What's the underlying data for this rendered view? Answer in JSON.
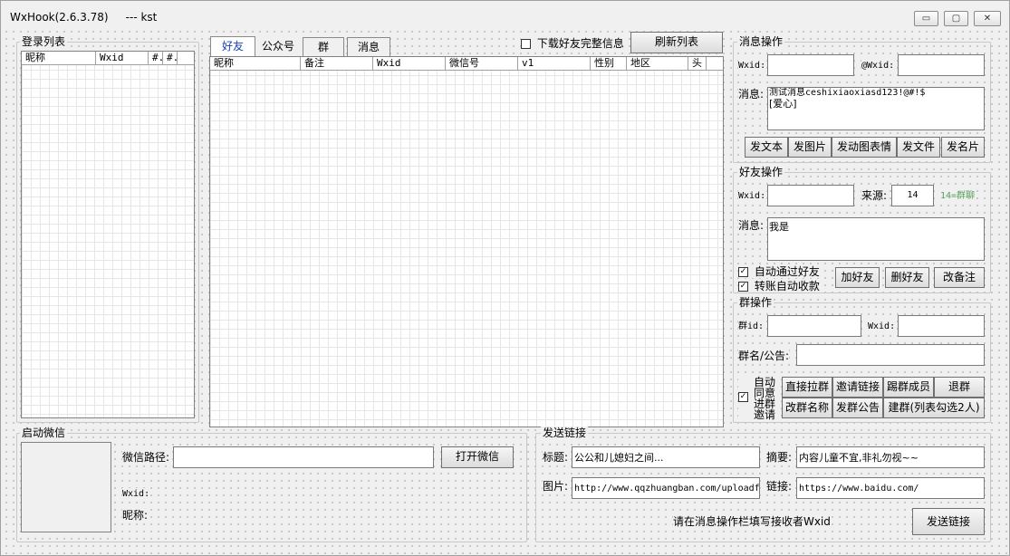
{
  "window": {
    "title": "WxHook(2.6.3.78)     --- kst",
    "minimize_glyph": "▭",
    "maximize_glyph": "▢",
    "close_glyph": "✕"
  },
  "login_list": {
    "title": "登录列表",
    "columns": [
      "昵称",
      "Wxid",
      "#.",
      "#."
    ]
  },
  "tabs": [
    "好友",
    "公众号",
    "群",
    "消息"
  ],
  "download_full_info": {
    "label": "下载好友完整信息",
    "checked": false
  },
  "refresh_button": "刷新列表",
  "friend_table": {
    "columns": [
      "昵称",
      "备注",
      "Wxid",
      "微信号",
      "v1",
      "性别",
      "地区",
      "头"
    ]
  },
  "message_ops": {
    "title": "消息操作",
    "wxid_label": "Wxid:",
    "at_wxid_label": "@Wxid:",
    "message_label": "消息:",
    "message_value_line1": "测试消息ceshixiaoxiasd123!@#!$",
    "message_value_line2": "[爱心]",
    "buttons": [
      "发文本",
      "发图片",
      "发动图表情",
      "发文件",
      "发名片"
    ]
  },
  "friend_ops": {
    "title": "好友操作",
    "wxid_label": "Wxid:",
    "source_label": "来源:",
    "source_value": "14",
    "source_hint": "14=群聊",
    "message_label": "消息:",
    "message_value": "我是",
    "auto_accept": {
      "label": "自动通过好友",
      "checked": true
    },
    "auto_collect": {
      "label": "转账自动收款",
      "checked": true
    },
    "buttons": [
      "加好友",
      "删好友",
      "改备注"
    ]
  },
  "group_ops": {
    "title": "群操作",
    "group_id_label": "群id:",
    "wxid_label": "Wxid:",
    "name_label": "群名/公告:",
    "auto_agree_label": "自动同意进群邀请",
    "auto_agree_lines": [
      "自动",
      "同意",
      "进群",
      "邀请"
    ],
    "auto_agree_checked": true,
    "buttons_row1": [
      "直接拉群",
      "邀请链接",
      "踢群成员",
      "退群"
    ],
    "buttons_row2": [
      "改群名称",
      "发群公告",
      "建群(列表勾选2人)"
    ]
  },
  "start_wechat": {
    "title": "启动微信",
    "path_label": "微信路径:",
    "open_button": "打开微信",
    "wxid_label": "Wxid:",
    "nickname_label": "昵称:"
  },
  "send_link": {
    "title": "发送链接",
    "title_label": "标题:",
    "title_value": "公公和儿媳妇之间...",
    "summary_label": "摘要:",
    "summary_value": "内容儿童不宜,非礼勿视~~",
    "image_label": "图片:",
    "image_value": "http://www.qqzhuangban.com/uploadfi",
    "link_label": "链接:",
    "link_value": "https://www.baidu.com/",
    "hint": "请在消息操作栏填写接收者Wxid",
    "send_button": "发送链接"
  }
}
